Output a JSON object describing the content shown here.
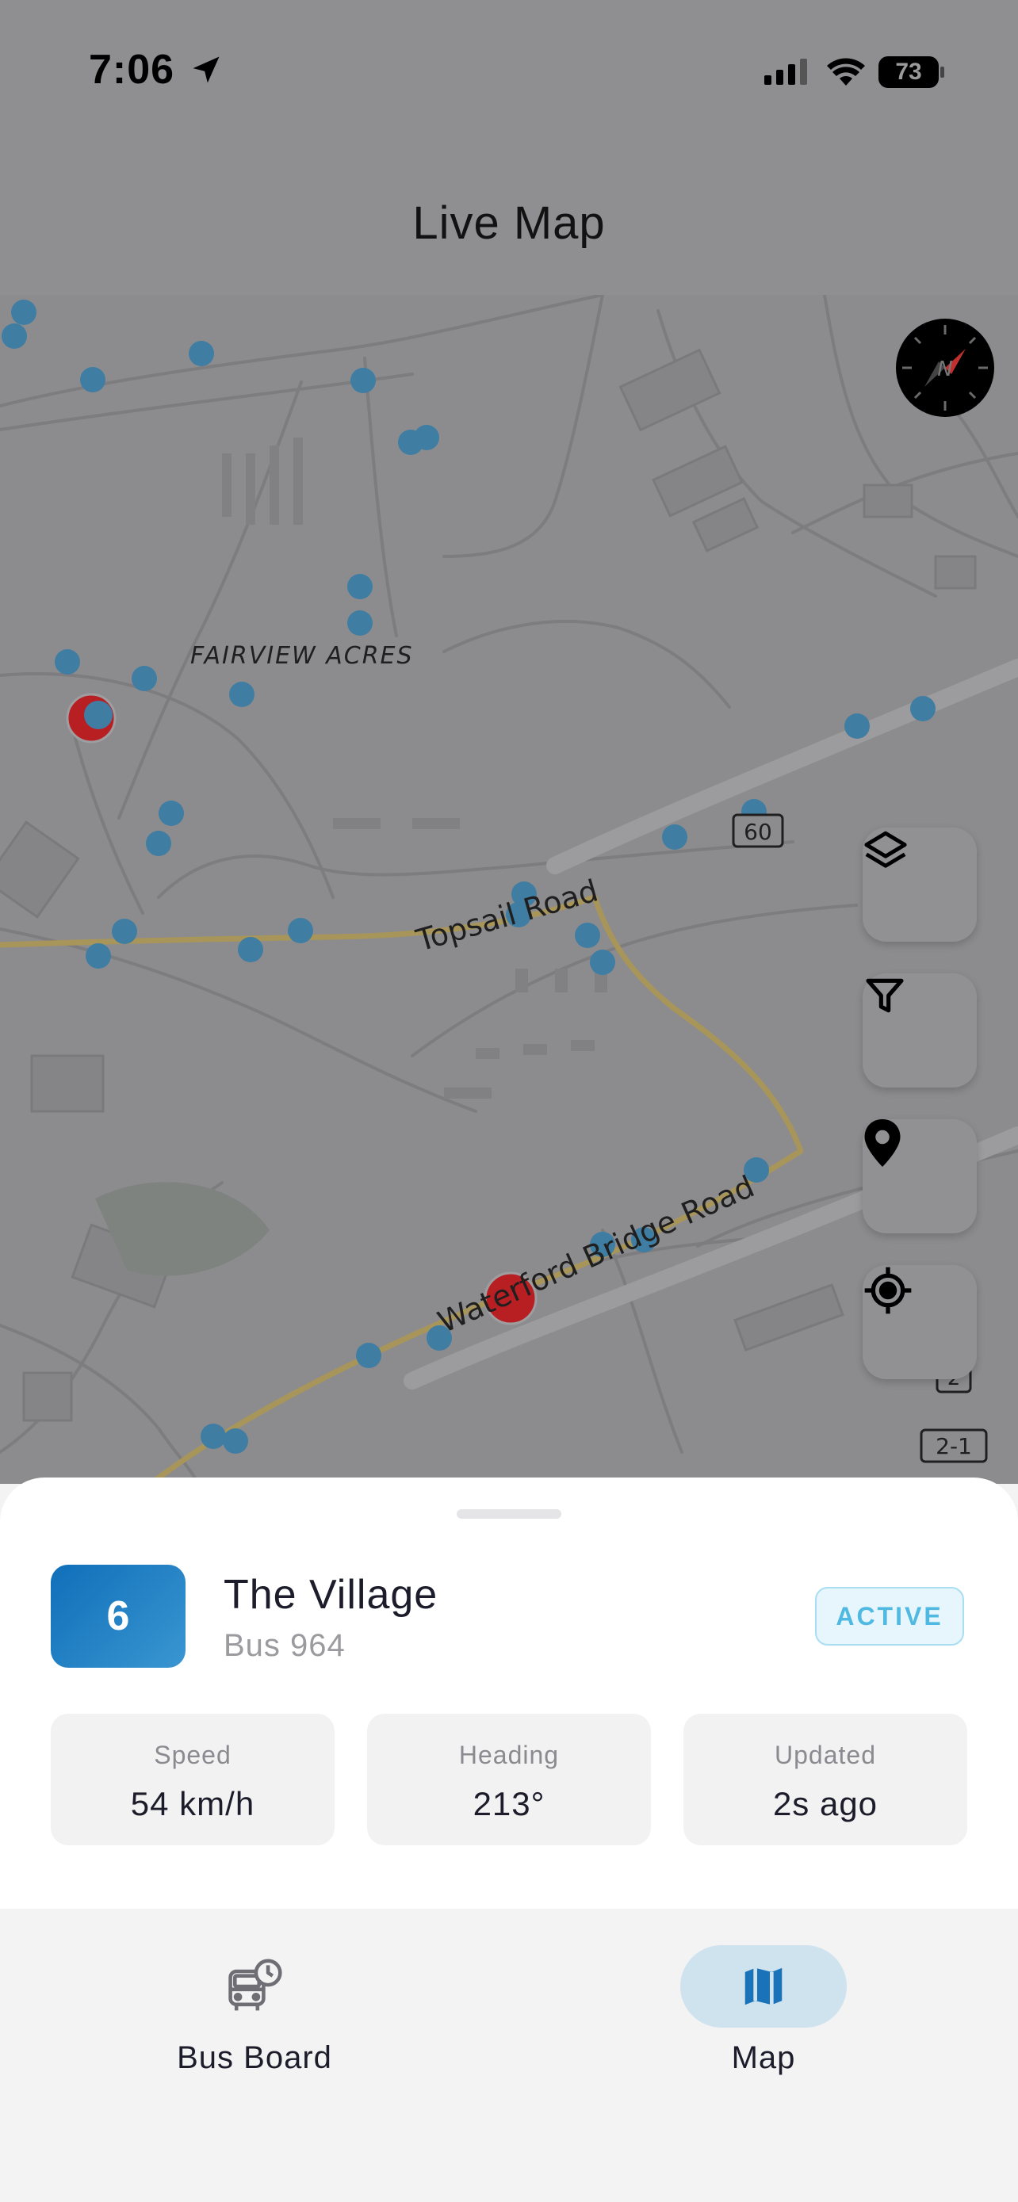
{
  "status_bar": {
    "time": "7:06",
    "battery": "73"
  },
  "header": {
    "title": "Live Map"
  },
  "map": {
    "labels": {
      "neighborhood": "FAIRVIEW ACRES",
      "road_1": "Topsail Road",
      "road_2": "Waterford Bridge Road",
      "shield_60": "60",
      "shield_2": "2",
      "shield_2_1": "2-1"
    },
    "controls": [
      "layers",
      "filter",
      "location-pin",
      "locate-me"
    ],
    "colors": {
      "stop_dot": "#3f7da3",
      "bus_marker": "#b71f23",
      "route_line": "#a8955a"
    }
  },
  "sheet": {
    "route_number": "6",
    "route_name": "The Village",
    "bus_name": "Bus 964",
    "status": "ACTIVE",
    "stats": [
      {
        "label": "Speed",
        "value": "54 km/h"
      },
      {
        "label": "Heading",
        "value": "213°"
      },
      {
        "label": "Updated",
        "value": "2s ago"
      }
    ]
  },
  "tabs": [
    {
      "label": "Bus Board",
      "icon": "bus-clock-icon",
      "active": false
    },
    {
      "label": "Map",
      "icon": "map-icon",
      "active": true
    }
  ],
  "colors": {
    "accent": "#1a73b8",
    "active_pill": "#cfe3ef",
    "active_badge_text": "#4fb9e2"
  }
}
